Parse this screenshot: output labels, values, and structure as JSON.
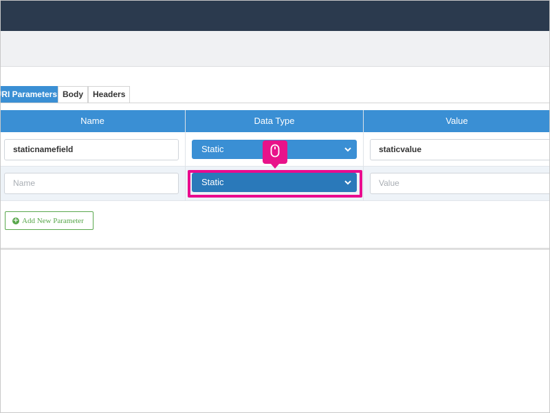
{
  "tabs": [
    {
      "label": "URI Parameters",
      "active": true
    },
    {
      "label": "Body",
      "active": false
    },
    {
      "label": "Headers",
      "active": false
    }
  ],
  "table": {
    "columns": [
      "Name",
      "Data Type",
      "Value"
    ],
    "rows": [
      {
        "name_value": "staticnamefield",
        "data_type": "Static",
        "value_value": "staticvalue"
      },
      {
        "name_placeholder": "Name",
        "data_type": "Static",
        "value_placeholder": "Value"
      }
    ]
  },
  "add_button_label": "Add New Parameter",
  "icons": {
    "chevron": "chevron-down-icon",
    "mouse": "mouse-icon",
    "add": "plus-circle-icon"
  },
  "colors": {
    "header_bar": "#2b3a4e",
    "accent": "#3a8fd4",
    "highlight": "#ea0a8e",
    "add_green": "#57a64a"
  }
}
